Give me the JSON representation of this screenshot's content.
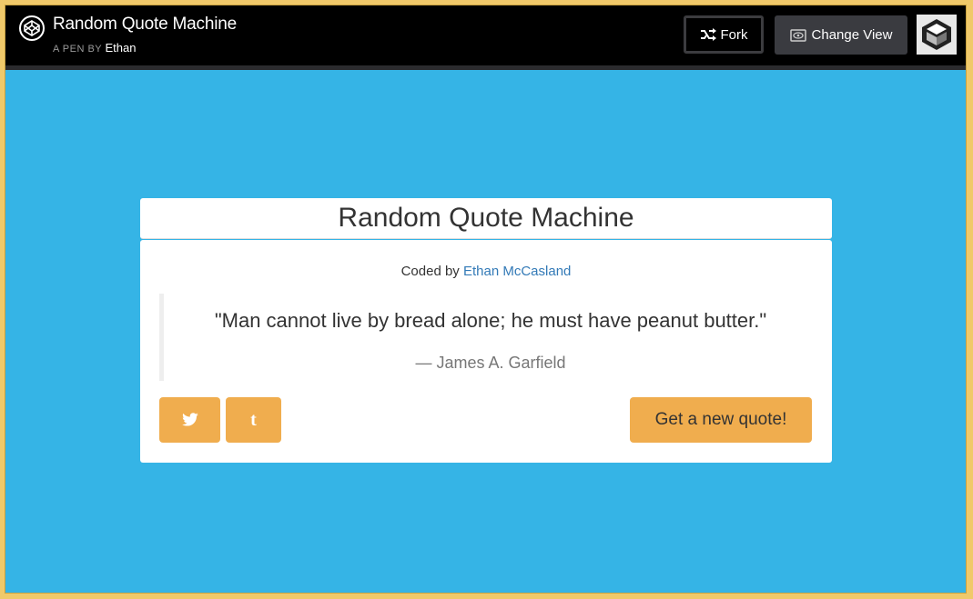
{
  "header": {
    "title": "Random Quote Machine",
    "byline_prefix": "A PEN BY",
    "author": "Ethan",
    "fork_label": "Fork",
    "change_view_label": "Change View"
  },
  "card": {
    "heading": "Random Quote Machine",
    "coded_by_prefix": "Coded by",
    "coder_name": "Ethan McCasland",
    "quote": "\"Man cannot live by bread alone; he must have peanut butter.\"",
    "quote_author": "— James A. Garfield",
    "tumblr_glyph": "t",
    "new_quote_label": "Get a new quote!"
  },
  "icons": {
    "logo": "codepen-logo-icon",
    "fork": "fork-icon",
    "view": "eye-icon",
    "avatar": "user-avatar",
    "twitter": "twitter-icon",
    "tumblr": "tumblr-icon"
  },
  "colors": {
    "background": "#35b4e6",
    "topbar": "#000000",
    "button": "#f0ad4e",
    "link": "#337ab7"
  }
}
